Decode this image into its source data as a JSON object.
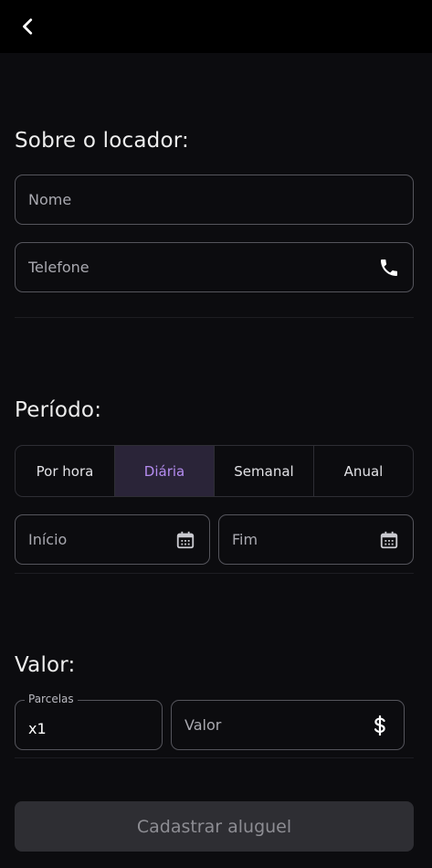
{
  "header": {
    "back_icon": "chevron-left-icon"
  },
  "locador": {
    "title": "Sobre o locador:",
    "name_placeholder": "Nome",
    "phone_placeholder": "Telefone",
    "phone_icon": "phone-icon"
  },
  "periodo": {
    "title": "Período:",
    "segments": [
      "Por hora",
      "Diária",
      "Semanal",
      "Anual"
    ],
    "selected": "Diária",
    "start_placeholder": "Início",
    "end_placeholder": "Fim",
    "calendar_icon": "calendar-icon"
  },
  "valor": {
    "title": "Valor:",
    "installments_label": "Parcelas",
    "installments_value": "x1",
    "amount_placeholder": "Valor",
    "amount_icon": "dollar-icon"
  },
  "submit": {
    "label": "Cadastrar aluguel"
  },
  "colors": {
    "background": "#0c0c0f",
    "topbar": "#000000",
    "accent": "#b58cf0",
    "accent_bg": "#2a2438",
    "field_border": "#55555c",
    "button_bg": "#2e2e33"
  }
}
